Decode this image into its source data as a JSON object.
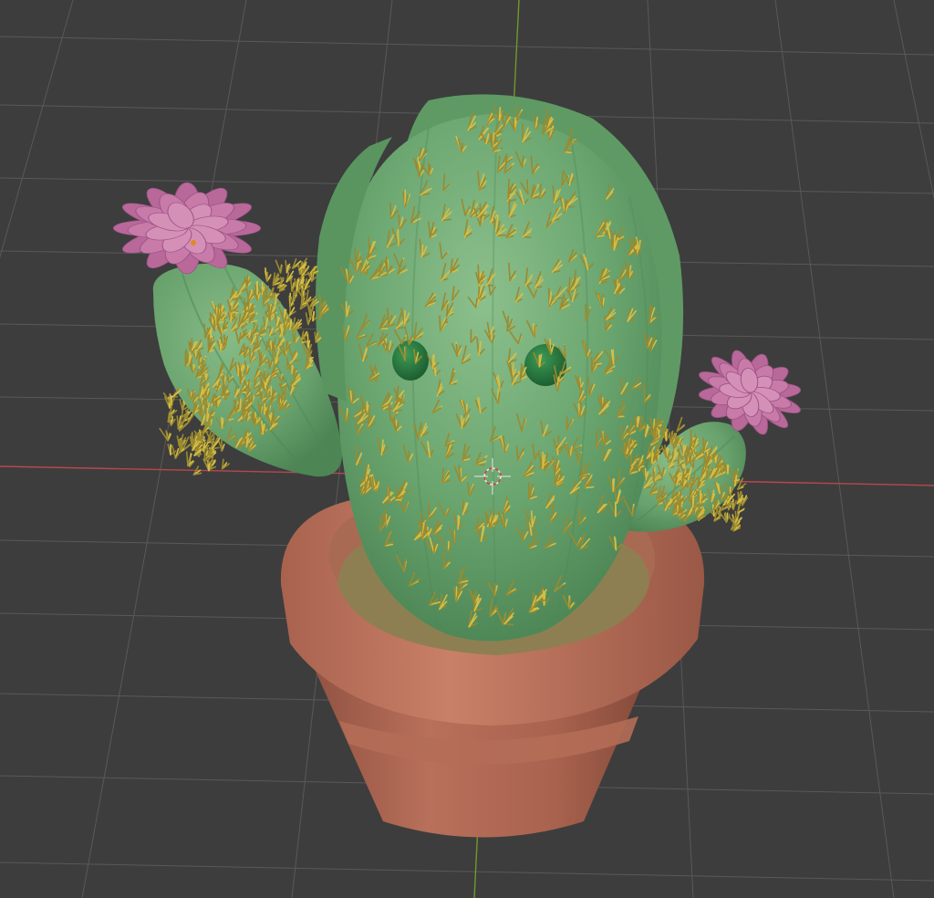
{
  "viewport": {
    "background": "#3d3d3d",
    "grid_color": "#595959",
    "x_axis_color": "#b8474f",
    "y_axis_color": "#6f9a2a"
  },
  "scene": {
    "body_color": "#6aa56f",
    "body_shadow_color": "#4f8857",
    "body_highlight_color": "#8cc08d",
    "spine_color": "#d6be45",
    "spine_shadow_color": "#9a8a30",
    "eye_color": "#1f6a37",
    "eye_highlight_color": "#3c9a55",
    "flower_color": "#c87aa8",
    "flower_dark_color": "#9a5384",
    "flower_center_color": "#e08a1e",
    "pot_color": "#b8705a",
    "pot_dark_color": "#8e5040",
    "pot_rim_color": "#c98068",
    "soil_color": "#8e7f52",
    "cursor_color": "#e8e8e8",
    "objects": [
      "cactus-body",
      "left-arm",
      "right-arm",
      "left-flower",
      "right-flower",
      "eye-left",
      "eye-right",
      "pot",
      "soil",
      "3d-cursor"
    ]
  }
}
